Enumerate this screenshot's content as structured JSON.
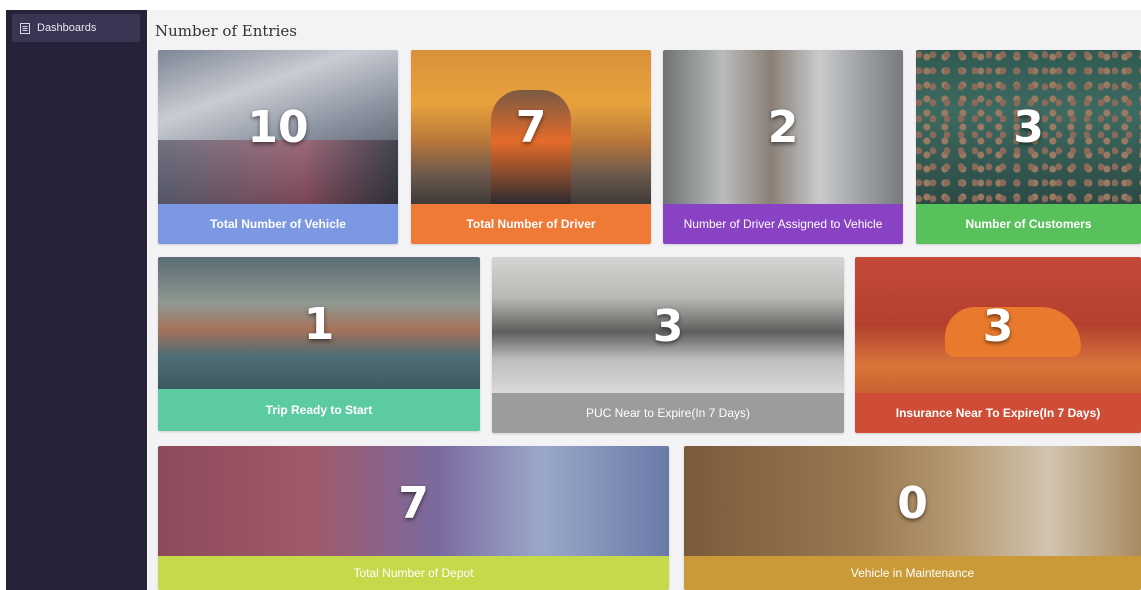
{
  "sidebar": {
    "items": [
      {
        "label": "Dashboards",
        "icon": "document-list-icon"
      }
    ]
  },
  "page": {
    "title": "Number of Entries"
  },
  "cards": [
    {
      "value": "10",
      "label": "Total Number of Vehicle",
      "color": "#7d98e3"
    },
    {
      "value": "7",
      "label": "Total Number of Driver",
      "color": "#ef7a38"
    },
    {
      "value": "2",
      "label": "Number of Driver Assigned to Vehicle",
      "color": "#8a42c5"
    },
    {
      "value": "3",
      "label": "Number of Customers",
      "color": "#58c15b"
    },
    {
      "value": "1",
      "label": "Trip Ready to Start",
      "color": "#5ccba1"
    },
    {
      "value": "3",
      "label": "PUC Near to Expire(In 7 Days)",
      "color": "#9e9c9b"
    },
    {
      "value": "3",
      "label": "Insurance Near To Expire(In 7 Days)",
      "color": "#cf4d36"
    },
    {
      "value": "7",
      "label": "Total Number of Depot",
      "color": "#c6d94a"
    },
    {
      "value": "0",
      "label": "Vehicle in Maintenance",
      "color": "#c99a37"
    }
  ]
}
